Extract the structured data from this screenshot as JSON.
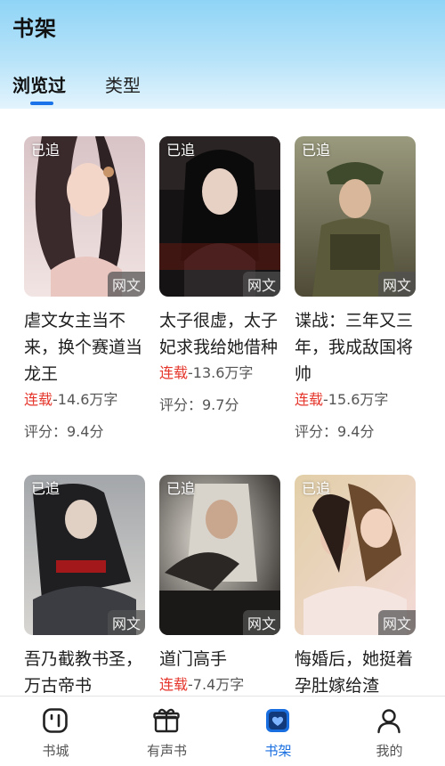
{
  "header": {
    "title": "书架"
  },
  "tabs": [
    {
      "label": "浏览过",
      "active": true
    },
    {
      "label": "类型",
      "active": false
    }
  ],
  "books": [
    {
      "title": "虐文女主当不来，换个赛道当龙王",
      "followed": "已追",
      "source": "网文",
      "status": "连载",
      "words": "-14.6万字",
      "rating": "评分：9.4分"
    },
    {
      "title": "太子很虚，太子妃求我给她借种",
      "followed": "已追",
      "source": "网文",
      "status": "连载",
      "words": "-13.6万字",
      "rating": "评分：9.7分"
    },
    {
      "title": "谍战：三年又三年，我成敌国将帅",
      "followed": "已追",
      "source": "网文",
      "status": "连载",
      "words": "-15.6万字",
      "rating": "评分：9.4分"
    },
    {
      "title": "吾乃截教书圣，万古帝书",
      "followed": "已追",
      "source": "网文",
      "status": "",
      "words": "",
      "rating": ""
    },
    {
      "title": "道门高手",
      "followed": "已追",
      "source": "网文",
      "status": "连载",
      "words": "-7.4万字",
      "rating": ""
    },
    {
      "title": "悔婚后，她挺着孕肚嫁给渣",
      "followed": "已追",
      "source": "网文",
      "status": "",
      "words": "",
      "rating": ""
    }
  ],
  "bottom_nav": [
    {
      "label": "书城",
      "icon": "bookstore-icon",
      "active": false
    },
    {
      "label": "有声书",
      "icon": "gift-box-icon",
      "active": false
    },
    {
      "label": "书架",
      "icon": "bookshelf-heart-icon",
      "active": true
    },
    {
      "label": "我的",
      "icon": "user-icon",
      "active": false
    }
  ],
  "colors": {
    "accent": "#1a6fe0",
    "status_red": "#e5352b",
    "header_blue": "#8fd4f6"
  }
}
